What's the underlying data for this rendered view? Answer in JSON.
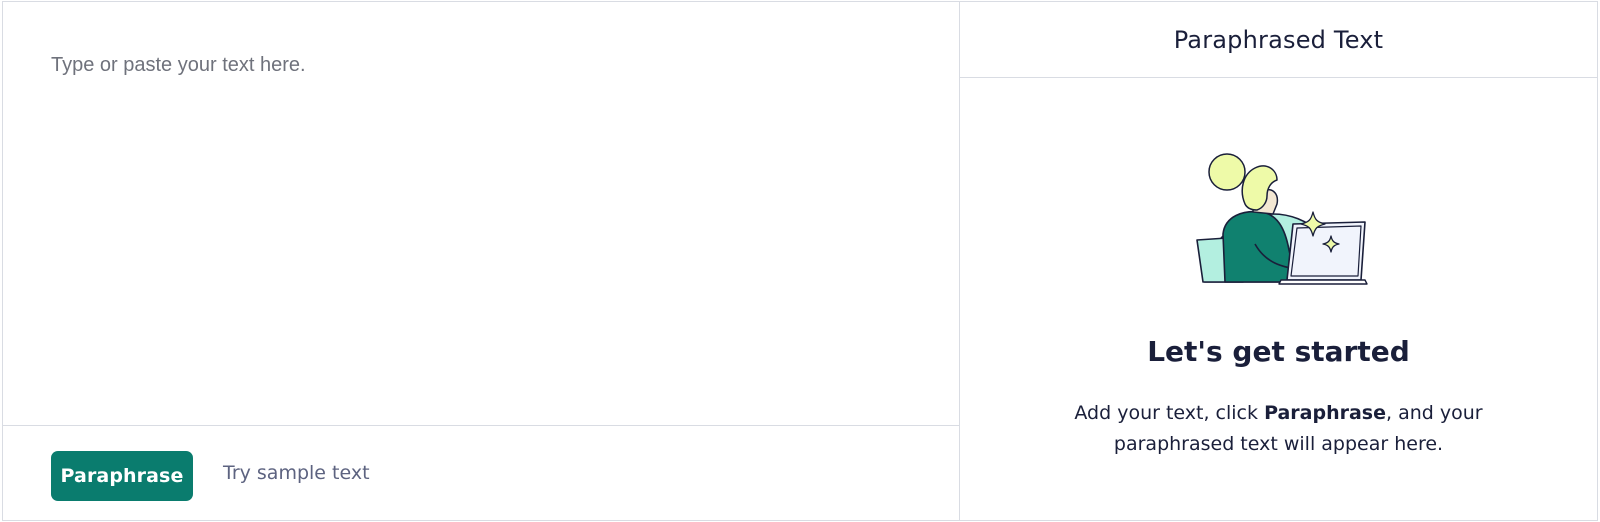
{
  "editor": {
    "placeholder": "Type or paste your text here.",
    "value": ""
  },
  "footer": {
    "paraphrase_label": "Paraphrase",
    "sample_label": "Try sample text"
  },
  "output": {
    "title": "Paraphrased Text",
    "empty_heading": "Let's get started",
    "empty_desc_before": "Add your text, click ",
    "empty_desc_bold": "Paraphrase",
    "empty_desc_after": ", and your paraphrased text will appear here."
  },
  "colors": {
    "primary": "#0a7c6e",
    "text": "#1a1f3a",
    "muted": "#5d6380",
    "border": "#d9dce3",
    "illustration_teal": "#b3efe0",
    "illustration_yellow": "#eefaa8",
    "illustration_green": "#10816f"
  },
  "icons": {
    "illustration": "person-at-laptop-illustration"
  }
}
